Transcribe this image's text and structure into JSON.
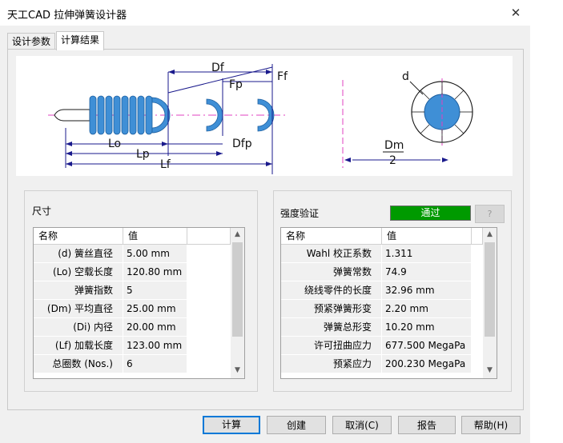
{
  "window": {
    "title": "天工CAD 拉伸弹簧设计器"
  },
  "tabs": [
    {
      "label": "设计参数",
      "active": false
    },
    {
      "label": "计算结果",
      "active": true
    }
  ],
  "diagram": {
    "labels": {
      "Df": "Df",
      "Fp": "Fp",
      "Ff": "Ff",
      "Lo": "Lo",
      "Lp": "Lp",
      "Lf": "Lf",
      "Dfp": "Dfp",
      "d": "d",
      "Dm": "Dm",
      "two": "2"
    }
  },
  "size_section": {
    "title": "尺寸",
    "headers": [
      "名称",
      "值",
      ""
    ],
    "rows": [
      {
        "name": "(d) 簧丝直径",
        "value": "5.00 mm"
      },
      {
        "name": "(Lo) 空载长度",
        "value": "120.80 mm"
      },
      {
        "name": "弹簧指数",
        "value": "5"
      },
      {
        "name": "(Dm) 平均直径",
        "value": "25.00 mm"
      },
      {
        "name": "(Di) 内径",
        "value": "20.00 mm"
      },
      {
        "name": "(Lf) 加载长度",
        "value": "123.00 mm"
      },
      {
        "name": "总圈数 (Nos.)",
        "value": "6"
      }
    ]
  },
  "strength_section": {
    "title": "强度验证",
    "status": "通过",
    "status_color": "#009a00",
    "help_label": "?",
    "headers": [
      "名称",
      "值",
      ""
    ],
    "rows": [
      {
        "name": "Wahl 校正系数",
        "value": "1.311"
      },
      {
        "name": "弹簧常数",
        "value": "74.9"
      },
      {
        "name": "绕线零件的长度",
        "value": "32.96 mm"
      },
      {
        "name": "预紧弹簧形变",
        "value": "2.20 mm"
      },
      {
        "name": "弹簧总形变",
        "value": "10.20 mm"
      },
      {
        "name": "许可扭曲应力",
        "value": "677.500 MegaPa"
      },
      {
        "name": "预紧应力",
        "value": "200.230 MegaPa"
      }
    ]
  },
  "buttons": {
    "calculate": "计算",
    "create": "创建",
    "cancel": "取消(C)",
    "report": "报告",
    "help": "帮助(H)"
  },
  "icons": {
    "close": "close-icon",
    "scroll_up": "chevron-up-icon",
    "scroll_down": "chevron-down-icon"
  },
  "colors": {
    "spring": "#3f8fd6",
    "dimension": "#1a1a8c",
    "axis": "#e040c0",
    "pass": "#009a00"
  }
}
